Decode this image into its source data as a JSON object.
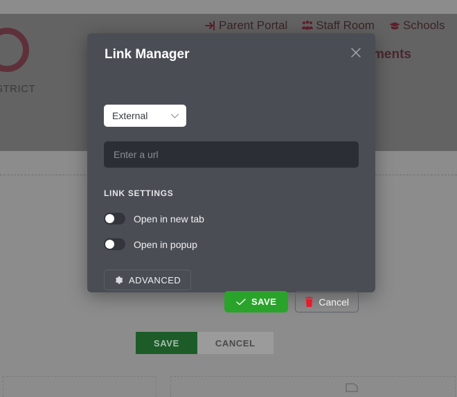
{
  "background_page": {
    "logo_text": "STRICT",
    "logo_icon": "ring-logo-icon",
    "menu_partial_text": "ments",
    "topnav": [
      {
        "label": "Parent Portal",
        "icon": "sign-in-arrow-icon"
      },
      {
        "label": "Staff Room",
        "icon": "people-group-icon"
      },
      {
        "label": "Schools",
        "icon": "graduation-cap-icon"
      }
    ],
    "page_actions": {
      "save_label": "SAVE",
      "cancel_label": "CANCEL"
    },
    "bottom_panel_icon": "document-icon"
  },
  "modal": {
    "title": "Link Manager",
    "close_icon": "close-icon",
    "link_type": {
      "selected": "External",
      "chevron_icon": "chevron-down-icon"
    },
    "url_field": {
      "value": "",
      "placeholder": "Enter a url"
    },
    "settings_heading": "LINK SETTINGS",
    "toggles": [
      {
        "label": "Open in new tab",
        "state": "off"
      },
      {
        "label": "Open in popup",
        "state": "off"
      }
    ],
    "advanced": {
      "label": "ADVANCED",
      "icon": "gear-icon"
    },
    "actions": {
      "save_label": "SAVE",
      "save_icon": "check-icon",
      "cancel_label": "Cancel",
      "cancel_icon": "trash-icon"
    }
  },
  "colors": {
    "modal_bg": "#4a4d54",
    "input_bg": "#2b2e34",
    "save_green": "#2aa32a",
    "trash_red": "#e8192c",
    "brand_maroon": "#5d1f2b",
    "page_overlay": "#8c8c8c"
  }
}
